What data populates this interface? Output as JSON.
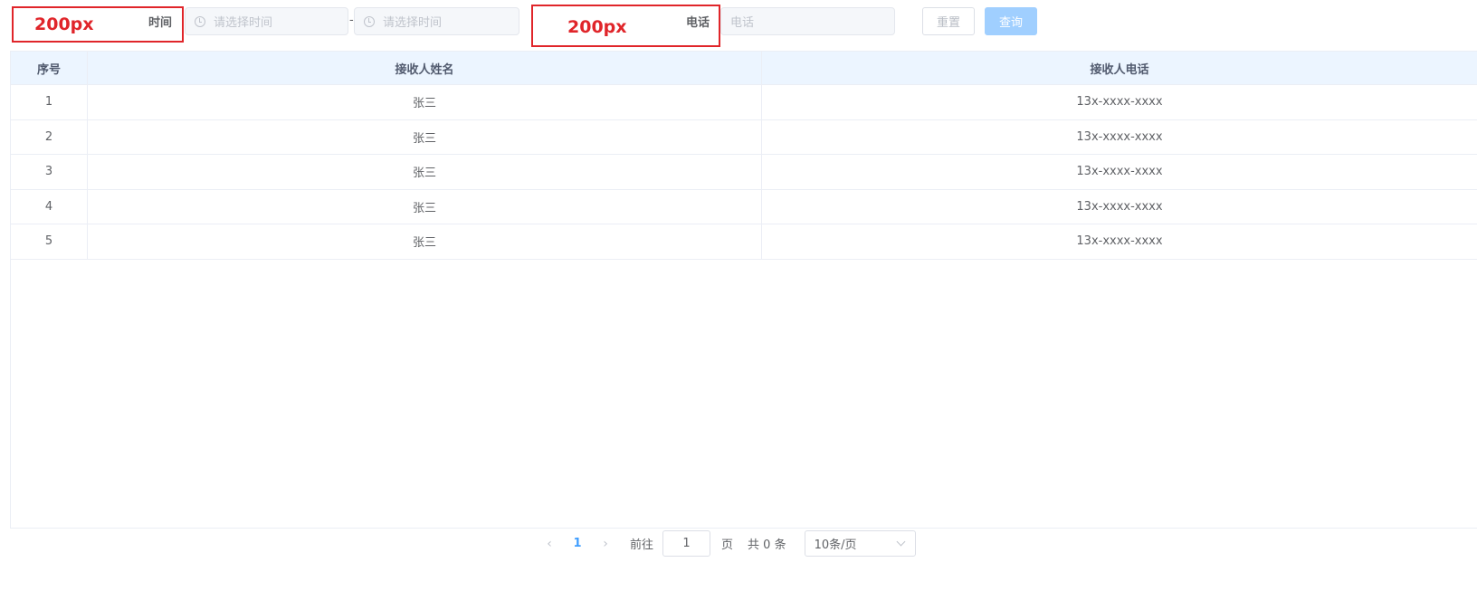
{
  "annotations": [
    {
      "text": "200px"
    },
    {
      "text": "200px"
    }
  ],
  "filters": {
    "time_label": "时间",
    "time_start_placeholder": "请选择时间",
    "range_separator": "-",
    "time_end_placeholder": "请选择时间",
    "phone_label": "电话",
    "phone_placeholder": "电话"
  },
  "buttons": {
    "reset": "重置",
    "search": "查询"
  },
  "table": {
    "headers": [
      "序号",
      "接收人姓名",
      "接收人电话"
    ],
    "rows": [
      [
        "1",
        "张三",
        "13x-xxxx-xxxx"
      ],
      [
        "2",
        "张三",
        "13x-xxxx-xxxx"
      ],
      [
        "3",
        "张三",
        "13x-xxxx-xxxx"
      ],
      [
        "4",
        "张三",
        "13x-xxxx-xxxx"
      ],
      [
        "5",
        "张三",
        "13x-xxxx-xxxx"
      ]
    ]
  },
  "pagination": {
    "prev": "‹",
    "current_page": "1",
    "next": "›",
    "goto_label": "前往",
    "goto_value": "1",
    "page_unit": "页",
    "total_text": "共 0 条",
    "page_size": "10条/页"
  },
  "colors": {
    "annotation": "#e0252a",
    "primary": "#409eff",
    "primary_disabled": "#a0cfff",
    "header_bg": "#ecf5ff"
  }
}
